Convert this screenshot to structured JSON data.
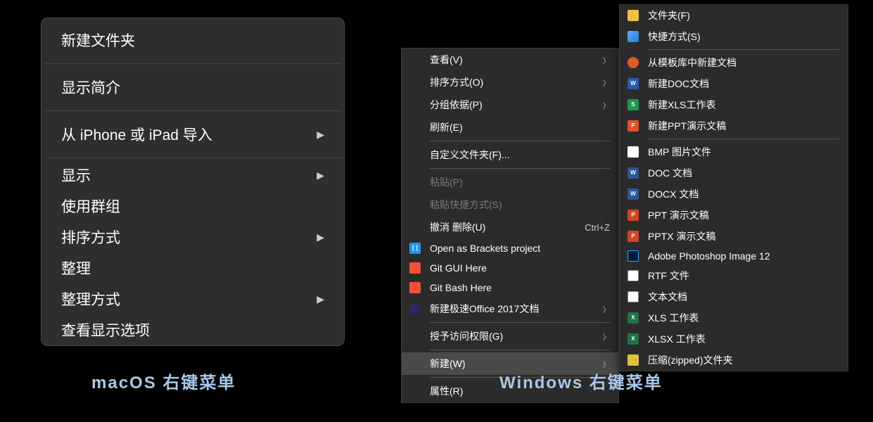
{
  "labels": {
    "macos": "macOS 右键菜单",
    "windows": "Windows 右键菜单"
  },
  "macos_menu": {
    "items": [
      {
        "label": "新建文件夹",
        "arrow": false,
        "big": true
      },
      {
        "label": "显示简介",
        "arrow": false,
        "big": true
      },
      {
        "label": "从 iPhone 或 iPad 导入",
        "arrow": true,
        "big": true
      },
      {
        "label": "显示",
        "arrow": true,
        "big": false
      },
      {
        "label": "使用群组",
        "arrow": false,
        "big": false
      },
      {
        "label": "排序方式",
        "arrow": true,
        "big": false
      },
      {
        "label": "整理",
        "arrow": false,
        "big": false
      },
      {
        "label": "整理方式",
        "arrow": true,
        "big": false
      },
      {
        "label": "查看显示选项",
        "arrow": false,
        "big": false
      }
    ]
  },
  "win_menu": {
    "items": [
      {
        "label": "查看(V)",
        "arrow": true
      },
      {
        "label": "排序方式(O)",
        "arrow": true
      },
      {
        "label": "分组依据(P)",
        "arrow": true
      },
      {
        "label": "刷新(E)"
      },
      {
        "sep": true
      },
      {
        "label": "自定义文件夹(F)..."
      },
      {
        "sep": true
      },
      {
        "label": "粘贴(P)",
        "disabled": true
      },
      {
        "label": "粘贴快捷方式(S)",
        "disabled": true
      },
      {
        "label": "撤消 删除(U)",
        "shortcut": "Ctrl+Z"
      },
      {
        "label": "Open as Brackets project",
        "icon": "brackets"
      },
      {
        "label": "Git GUI Here",
        "icon": "git"
      },
      {
        "label": "Git Bash Here",
        "icon": "git"
      },
      {
        "label": "新建极速Office 2017文档",
        "icon": "office",
        "arrow": true
      },
      {
        "sep": true
      },
      {
        "label": "授予访问权限(G)",
        "arrow": true
      },
      {
        "sep": true
      },
      {
        "label": "新建(W)",
        "arrow": true,
        "selected": true
      },
      {
        "sep": true
      },
      {
        "label": "属性(R)"
      }
    ]
  },
  "win_submenu": {
    "items": [
      {
        "label": "文件夹(F)",
        "icon": "folder"
      },
      {
        "label": "快捷方式(S)",
        "icon": "shortcut"
      },
      {
        "sep": true
      },
      {
        "label": "从模板库中新建文档",
        "icon": "template"
      },
      {
        "label": "新建DOC文档",
        "icon": "doc"
      },
      {
        "label": "新建XLS工作表",
        "icon": "xls"
      },
      {
        "label": "新建PPT演示文稿",
        "icon": "ppt"
      },
      {
        "sep": true
      },
      {
        "label": "BMP 图片文件",
        "icon": "bmp"
      },
      {
        "label": "DOC 文档",
        "icon": "docw"
      },
      {
        "label": "DOCX 文档",
        "icon": "docxw"
      },
      {
        "label": "PPT 演示文稿",
        "icon": "pptw"
      },
      {
        "label": "PPTX 演示文稿",
        "icon": "pptxw"
      },
      {
        "label": "Adobe Photoshop Image 12",
        "icon": "ps"
      },
      {
        "label": "RTF 文件",
        "icon": "rtf"
      },
      {
        "label": "文本文档",
        "icon": "txt"
      },
      {
        "label": "XLS 工作表",
        "icon": "xlsw"
      },
      {
        "label": "XLSX 工作表",
        "icon": "xlsxw"
      },
      {
        "label": "压缩(zipped)文件夹",
        "icon": "zip"
      }
    ]
  },
  "icon_letters": {
    "doc": "W",
    "xls": "S",
    "ppt": "P",
    "docw": "W",
    "docxw": "W",
    "pptw": "P",
    "pptxw": "P",
    "xlsw": "X",
    "xlsxw": "X",
    "brackets": "[ ]"
  }
}
